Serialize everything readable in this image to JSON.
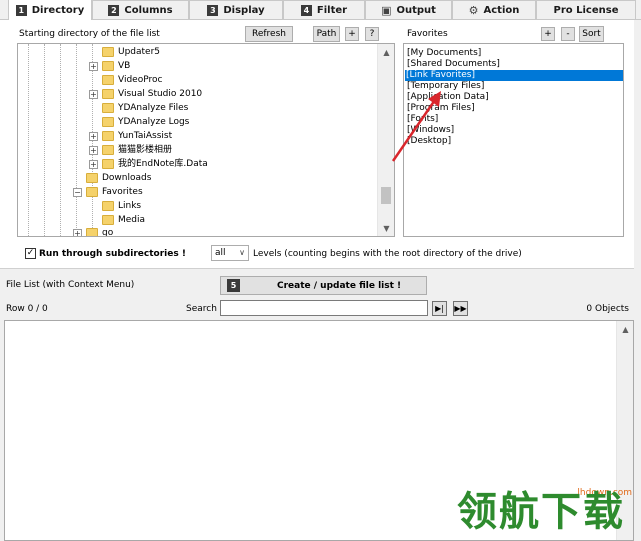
{
  "tabs": [
    {
      "num": "1",
      "label": "Directory",
      "active": true
    },
    {
      "num": "2",
      "label": "Columns"
    },
    {
      "num": "3",
      "label": "Display"
    },
    {
      "num": "4",
      "label": "Filter"
    },
    {
      "glyph": "▣",
      "label": "Output"
    },
    {
      "glyph": "⚙",
      "label": "Action"
    },
    {
      "label": "Pro License"
    }
  ],
  "directory": {
    "start_label": "Starting directory of the file list",
    "refresh_label": "Refresh",
    "path_label": "Path",
    "plus_label": "+",
    "help_label": "?",
    "tree": [
      {
        "label": "Updater5",
        "expander": false
      },
      {
        "label": "VB",
        "expander": true
      },
      {
        "label": "VideoProc",
        "expander": false
      },
      {
        "label": "Visual Studio 2010",
        "expander": true
      },
      {
        "label": "YDAnalyze Files",
        "expander": false
      },
      {
        "label": "YDAnalyze Logs",
        "expander": false
      },
      {
        "label": "YunTaiAssist",
        "expander": true
      },
      {
        "label": "猫猫影楼相册",
        "expander": true
      },
      {
        "label": "我的EndNote库.Data",
        "expander": true
      },
      {
        "label": "Downloads",
        "expander": false
      },
      {
        "label": "Favorites",
        "expander": "minus"
      },
      {
        "label": "Links",
        "expander": false
      },
      {
        "label": "Media",
        "expander": false
      },
      {
        "label": "go",
        "expander": true
      }
    ]
  },
  "favorites": {
    "label": "Favorites",
    "plus_label": "+",
    "minus_label": "-",
    "sort_label": "Sort",
    "items": [
      "[My Documents]",
      "[Shared Documents]",
      "[Link Favorites]",
      "[Temporary Files]",
      "[Application Data]",
      "[Program Files]",
      "[Fonts]",
      "[Windows]",
      "[Desktop]"
    ],
    "selected_index": 2
  },
  "options": {
    "run_subdirs_label": "Run through subdirectories !",
    "run_subdirs_checked": "✓",
    "levels_value": "all",
    "levels_label": "Levels  (counting begins with the root directory of the drive)"
  },
  "filelist": {
    "title": "File List (with Context Menu)",
    "create_num": "5",
    "create_label": "Create / update file list !",
    "row_label": "Row 0 / 0",
    "search_label": "Search",
    "search_value": "",
    "objects_label": "0 Objects"
  },
  "watermark": {
    "text": "领航下载",
    "sub": "lhdown.com"
  },
  "colors": {
    "selection": "#0078d7",
    "folder": "#f5d26b",
    "annotation_arrow": "#d9262c",
    "watermark": "#2e8b2e"
  }
}
